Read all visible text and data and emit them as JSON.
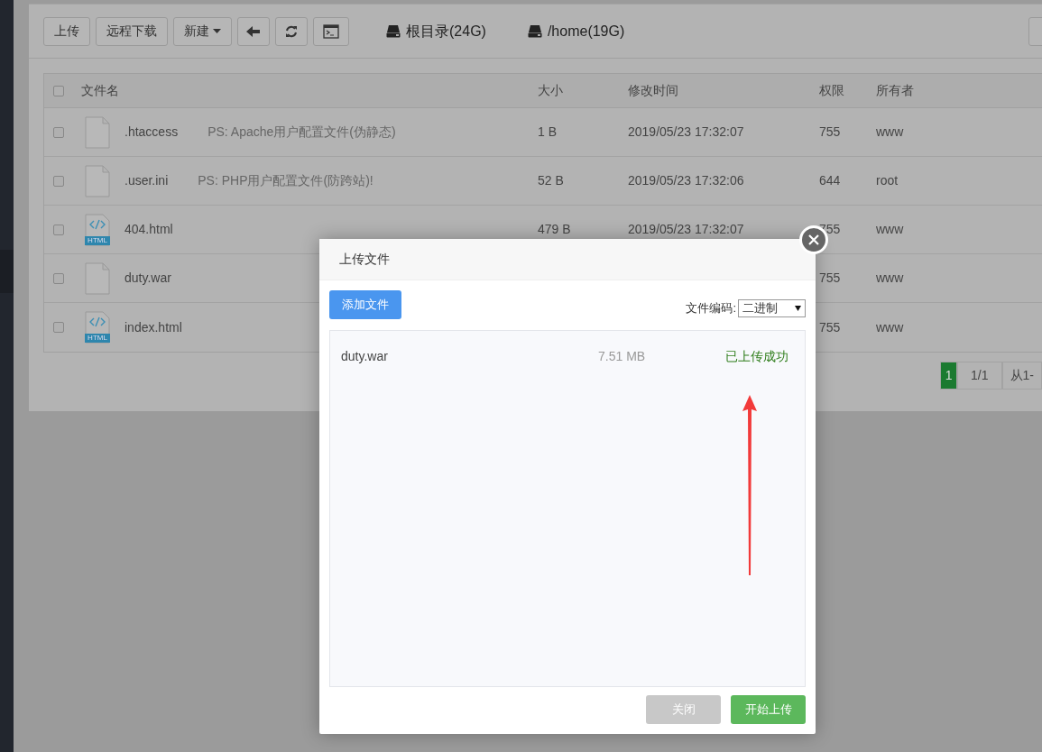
{
  "toolbar": {
    "buttons": [
      {
        "kind": "text",
        "label": "上传"
      },
      {
        "kind": "text",
        "label": "远程下载"
      },
      {
        "kind": "dropdown",
        "label": "新建"
      },
      {
        "kind": "back"
      },
      {
        "kind": "refresh"
      },
      {
        "kind": "terminal"
      }
    ],
    "disks": [
      {
        "label": "根目录(24G)"
      },
      {
        "label": "/home(19G)"
      }
    ]
  },
  "table": {
    "select_all_checked": false,
    "columns": [
      "文件名",
      "大小",
      "修改时间",
      "权限",
      "所有者"
    ],
    "rows": [
      {
        "checked": false,
        "kind": "blank",
        "name": ".htaccess",
        "note": "PS: Apache用户配置文件(伪静态)",
        "size": "1 B",
        "modified": "2019/05/23 17:32:07",
        "permission": "755",
        "owner": "www"
      },
      {
        "checked": false,
        "kind": "blank",
        "name": ".user.ini",
        "note": "PS: PHP用户配置文件(防跨站)!",
        "size": "52 B",
        "modified": "2019/05/23 17:32:06",
        "permission": "644",
        "owner": "root"
      },
      {
        "checked": false,
        "kind": "html",
        "badge": "HTML",
        "name": "404.html",
        "size": "479 B",
        "modified": "2019/05/23 17:32:07",
        "permission": "755",
        "owner": "www"
      },
      {
        "checked": false,
        "kind": "blank",
        "name": "duty.war",
        "permission": "755",
        "owner": "www"
      },
      {
        "checked": false,
        "kind": "html",
        "badge": "HTML",
        "name": "index.html",
        "permission": "755",
        "owner": "www"
      }
    ]
  },
  "pagination": {
    "pages": [
      {
        "label": "1",
        "selected": true
      }
    ],
    "page_count": "1/1",
    "range": "从1-"
  },
  "dialog": {
    "title": "上传文件",
    "add_button": "添加文件",
    "encoding_label": "文件编码:",
    "encoding_value": "二进制",
    "files": [
      {
        "name": "duty.war",
        "size": "7.51 MB",
        "status": "已上传成功"
      }
    ],
    "buttons": [
      {
        "kind": "neutral",
        "label": "关闭"
      },
      {
        "kind": "primary",
        "label": "开始上传"
      }
    ]
  }
}
